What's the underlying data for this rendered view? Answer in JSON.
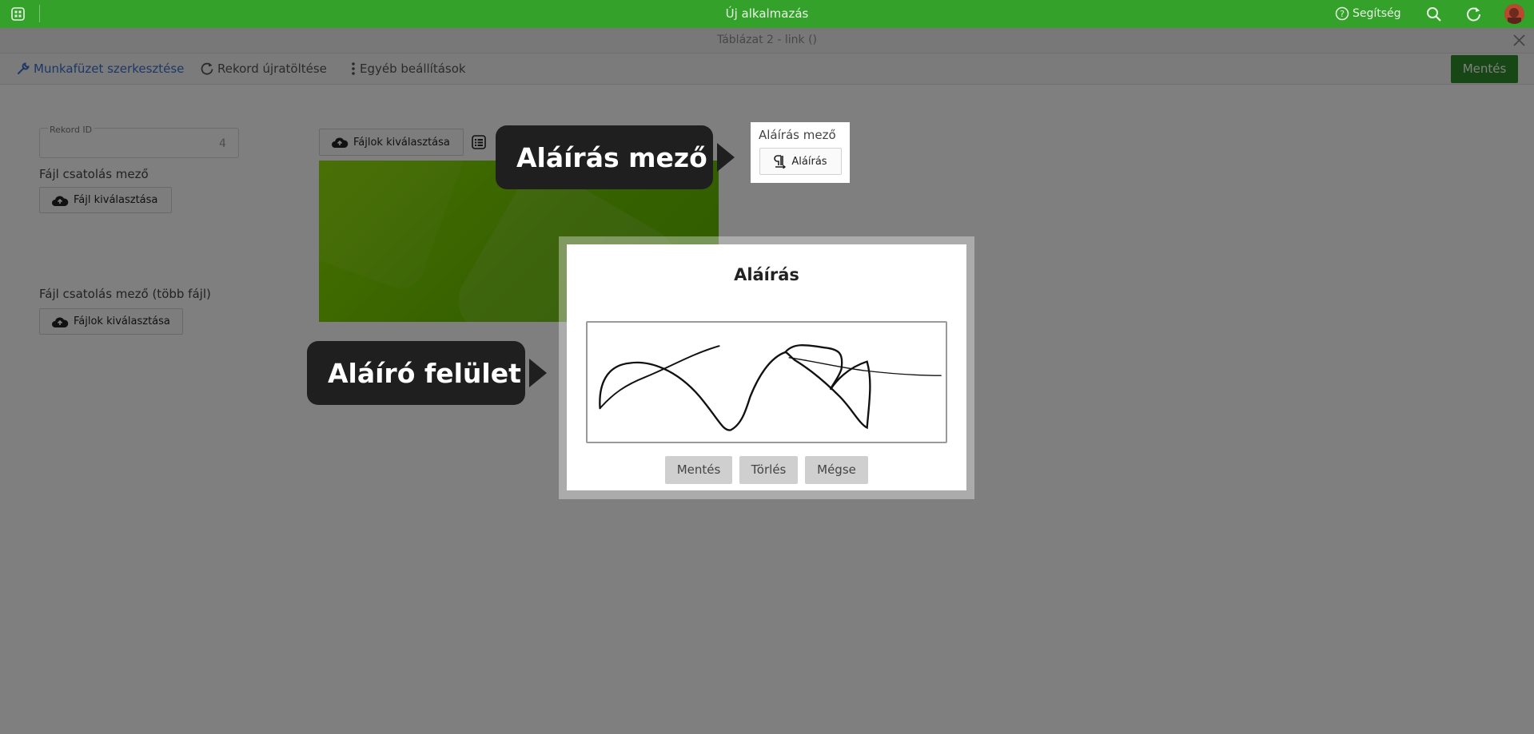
{
  "app": {
    "title": "Új alkalmazás",
    "help_label": "Segítség"
  },
  "dialog": {
    "title": "Táblázat 2 - link ()"
  },
  "toolbar": {
    "edit_workbook": "Munkafüzet szerkesztése",
    "reload_record": "Rekord újratöltése",
    "other_settings": "Egyéb beállítások",
    "save": "Mentés"
  },
  "form": {
    "record_id_label": "Rekord ID",
    "record_id_value": "4",
    "attachment_label": "Fájl csatolás mező",
    "attachment_button": "Fájl kiválasztása",
    "multi_attachment_label": "Fájl csatolás mező (több fájl)",
    "multi_attachment_button": "Fájlok kiválasztása",
    "files_button": "Fájlok kiválasztása",
    "signature_field_label": "Aláírás mező",
    "signature_button": "Aláírás"
  },
  "modal": {
    "title": "Aláírás",
    "buttons": {
      "save": "Mentés",
      "clear": "Törlés",
      "cancel": "Mégse"
    }
  },
  "callouts": {
    "signature_field": "Aláírás mező",
    "signing_surface": "Aláíró felület"
  },
  "colors": {
    "top_bar": "#34a12a",
    "save_button": "#2f8f2a",
    "link_blue": "#3a6fcf",
    "callout_bg": "#1f1f1f"
  },
  "icons": [
    "apps-icon",
    "help-icon",
    "search-icon",
    "reload-icon",
    "avatar",
    "close-icon",
    "wrench-icon",
    "refresh-icon",
    "more-vertical-icon",
    "cloud-upload-icon",
    "list-icon",
    "signature-icon"
  ]
}
